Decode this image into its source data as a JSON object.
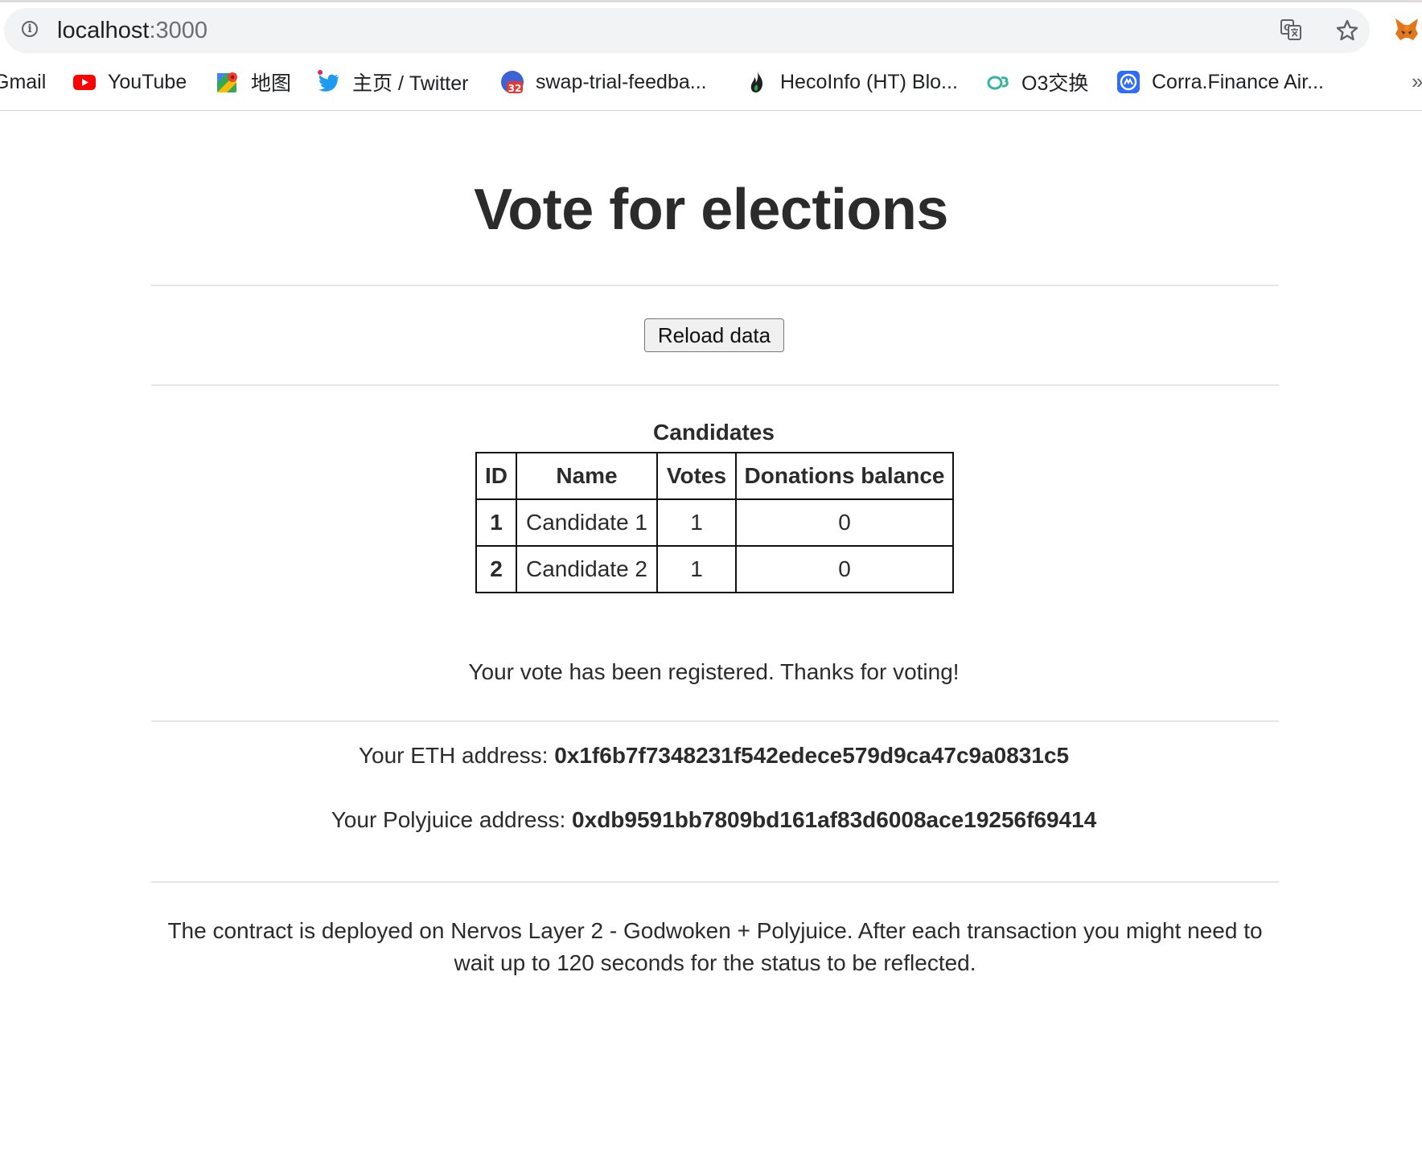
{
  "browser": {
    "url_host": "localhost",
    "url_port": ":3000",
    "bookmarks": [
      {
        "label": "Gmail",
        "icon": "gmail-icon"
      },
      {
        "label": "YouTube",
        "icon": "youtube-icon"
      },
      {
        "label": "地图",
        "icon": "maps-icon"
      },
      {
        "label": "主页 / Twitter",
        "icon": "twitter-icon"
      },
      {
        "label": "swap-trial-feedba...",
        "icon": "calendar-icon"
      },
      {
        "label": "HecoInfo (HT) Blo...",
        "icon": "heco-flame-icon"
      },
      {
        "label": "O3交换",
        "icon": "o3-icon"
      },
      {
        "label": "Corra.Finance Air...",
        "icon": "corra-icon"
      }
    ],
    "bookmarks_overflow": "»",
    "calendar_badge": "32"
  },
  "page": {
    "title": "Vote for elections",
    "reload_button": "Reload data",
    "table": {
      "caption": "Candidates",
      "headers": [
        "ID",
        "Name",
        "Votes",
        "Donations balance"
      ],
      "rows": [
        {
          "id": "1",
          "name": "Candidate 1",
          "votes": "1",
          "donations": "0"
        },
        {
          "id": "2",
          "name": "Candidate 2",
          "votes": "1",
          "donations": "0"
        }
      ]
    },
    "vote_message": "Your vote has been registered. Thanks for voting!",
    "eth_label": "Your ETH address: ",
    "eth_address": "0x1f6b7f7348231f542edece579d9ca47c9a0831c5",
    "polyjuice_label": "Your Polyjuice address: ",
    "polyjuice_address": "0xdb9591bb7809bd161af83d6008ace19256f69414",
    "footer_note": "The contract is deployed on Nervos Layer 2 - Godwoken + Polyjuice. After each transaction you might need to wait up to 120 seconds for the status to be reflected."
  },
  "colors": {
    "youtube": "#ff0000",
    "twitter": "#1d9bf0",
    "o3": "#36b3a0",
    "corra": "#2f6bff",
    "heco": "#1f8a3d"
  }
}
